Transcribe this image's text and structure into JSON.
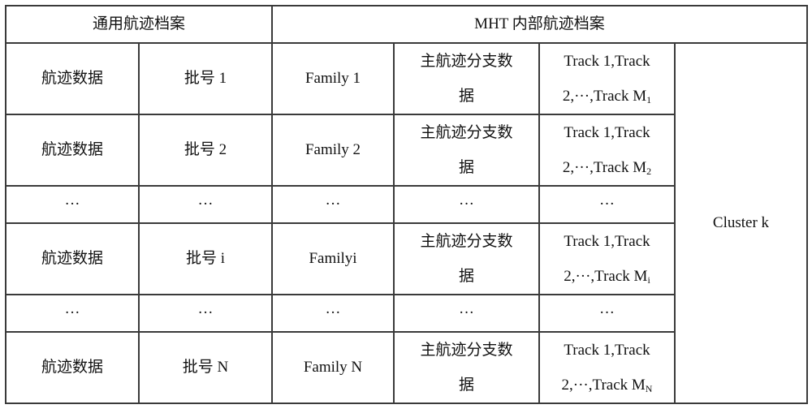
{
  "table": {
    "headers": [
      {
        "label": "通用航迹档案",
        "span": 2
      },
      {
        "label": "MHT 内部航迹档案",
        "span": 4
      }
    ],
    "rows": [
      {
        "track_data": "航迹数据",
        "batch": "批号 1",
        "family": "Family 1",
        "branch": "主航迹分支数据",
        "tracks_line1": "Track 1,Track",
        "tracks_line2": "2,···,Track M",
        "tracks_sub": "1"
      },
      {
        "track_data": "航迹数据",
        "batch": "批号 2",
        "family": "Family 2",
        "branch": "主航迹分支数据",
        "tracks_line1": "Track 1,Track",
        "tracks_line2": "2,···,Track M",
        "tracks_sub": "2"
      },
      {
        "ellipsis": "···"
      },
      {
        "track_data": "航迹数据",
        "batch": "批号 i",
        "family": "Familyi",
        "branch": "主航迹分支数据",
        "tracks_line1": "Track 1,Track",
        "tracks_line2": "2,···,Track M",
        "tracks_sub": "i"
      },
      {
        "ellipsis": "···"
      },
      {
        "track_data": "航迹数据",
        "batch": "批号 N",
        "family": "Family N",
        "branch": "主航迹分支数据",
        "tracks_line1": "Track 1,Track",
        "tracks_line2": "2,···,Track M",
        "tracks_sub": "N"
      }
    ],
    "cluster": "Cluster k",
    "branch_line1": "主航迹分支数",
    "branch_line2": "据"
  }
}
